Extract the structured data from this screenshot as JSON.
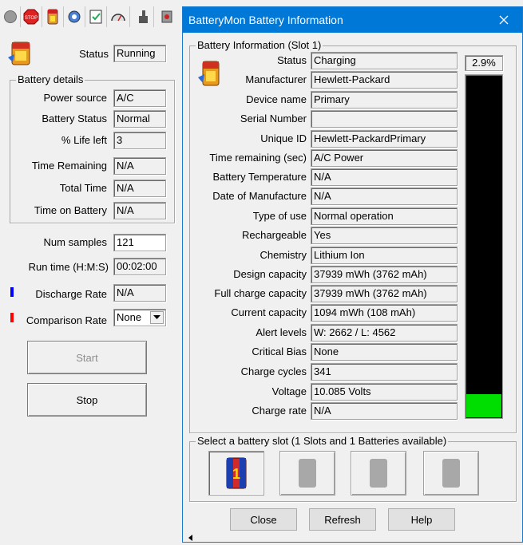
{
  "main": {
    "status_label": "Status",
    "status_value": "Running",
    "battery_details_title": "Battery details",
    "rows": [
      {
        "label": "Power source",
        "value": "A/C"
      },
      {
        "label": "Battery Status",
        "value": "Normal"
      },
      {
        "label": "% Life left",
        "value": "3"
      },
      {
        "label": "Time Remaining",
        "value": "N/A"
      },
      {
        "label": "Total Time",
        "value": "N/A"
      },
      {
        "label": "Time on Battery",
        "value": "N/A"
      }
    ],
    "num_samples_label": "Num samples",
    "num_samples_value": "121",
    "run_time_label": "Run time (H:M:S)",
    "run_time_value": "00:02:00",
    "discharge_rate_label": "Discharge Rate",
    "discharge_rate_value": "N/A",
    "discharge_color": "#0000ff",
    "comparison_rate_label": "Comparison Rate",
    "comparison_rate_value": "None",
    "comparison_color": "#ff0000",
    "start_label": "Start",
    "stop_label": "Stop",
    "toolbar_icons": [
      "record-icon",
      "stop-icon",
      "battery-icon",
      "settings-icon",
      "checklist-icon",
      "gauge-icon",
      "hand-icon",
      "info-icon"
    ]
  },
  "dialog": {
    "title": "BatteryMon Battery Information",
    "group_title": "Battery Information (Slot 1)",
    "fields": [
      {
        "label": "Status",
        "value": "Charging"
      },
      {
        "label": "Manufacturer",
        "value": "Hewlett-Packard"
      },
      {
        "label": "Device name",
        "value": "Primary"
      },
      {
        "label": "Serial Number",
        "value": ""
      },
      {
        "label": "Unique ID",
        "value": "Hewlett-PackardPrimary"
      },
      {
        "label": "Time remaining (sec)",
        "value": "A/C Power"
      },
      {
        "label": "Battery Temperature",
        "value": "N/A"
      },
      {
        "label": "Date of Manufacture",
        "value": "N/A"
      },
      {
        "label": "Type of use",
        "value": "Normal operation"
      },
      {
        "label": "Rechargeable",
        "value": "Yes"
      },
      {
        "label": "Chemistry",
        "value": "Lithium Ion"
      },
      {
        "label": "Design capacity",
        "value": "37939 mWh (3762 mAh)"
      },
      {
        "label": "Full charge capacity",
        "value": "37939 mWh (3762 mAh)"
      },
      {
        "label": "Current capacity",
        "value": "1094 mWh (108 mAh)"
      },
      {
        "label": "Alert levels",
        "value": "W: 2662 / L: 4562"
      },
      {
        "label": "Critical Bias",
        "value": "None"
      },
      {
        "label": "Charge cycles",
        "value": "341"
      },
      {
        "label": "Voltage",
        "value": "10.085 Volts"
      },
      {
        "label": "Charge rate",
        "value": "N/A"
      }
    ],
    "charge_percent_text": "2.9%",
    "charge_level_fraction": 0.029,
    "level_fill_color": "#00dd00",
    "level_bg_color": "#000000",
    "slot_group_title": "Select a battery slot (1 Slots and 1 Batteries available)",
    "close_label": "Close",
    "refresh_label": "Refresh",
    "help_label": "Help"
  }
}
